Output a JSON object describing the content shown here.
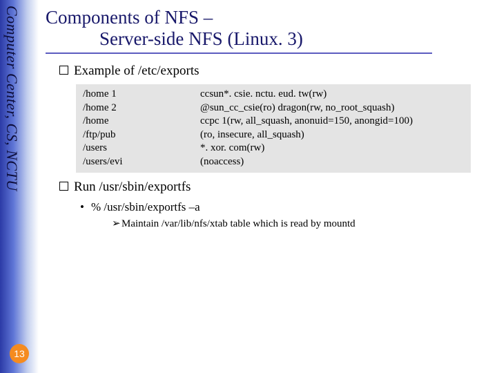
{
  "sidebar": {
    "text": "Computer Center, CS, NCTU"
  },
  "page_number": "13",
  "title": {
    "line1": "Components of NFS –",
    "line2": "Server-side NFS (Linux. 3)"
  },
  "bullet1": "Example of /etc/exports",
  "exports": [
    {
      "path": "/home 1",
      "opts": "ccsun*. csie. nctu. eud. tw(rw)"
    },
    {
      "path": "/home 2",
      "opts": "@sun_cc_csie(ro)  dragon(rw, no_root_squash)"
    },
    {
      "path": "/home",
      "opts": "ccpc 1(rw, all_squash, anonuid=150, anongid=100)"
    },
    {
      "path": "/ftp/pub",
      "opts": "(ro, insecure, all_squash)"
    },
    {
      "path": "/users",
      "opts": "*. xor. com(rw)"
    },
    {
      "path": "/users/evi",
      "opts": "(noaccess)"
    }
  ],
  "bullet2": "Run /usr/sbin/exportfs",
  "sub_bullet": "% /usr/sbin/exportfs –a",
  "sub_sub": "Maintain /var/lib/nfs/xtab table which is read by mountd"
}
